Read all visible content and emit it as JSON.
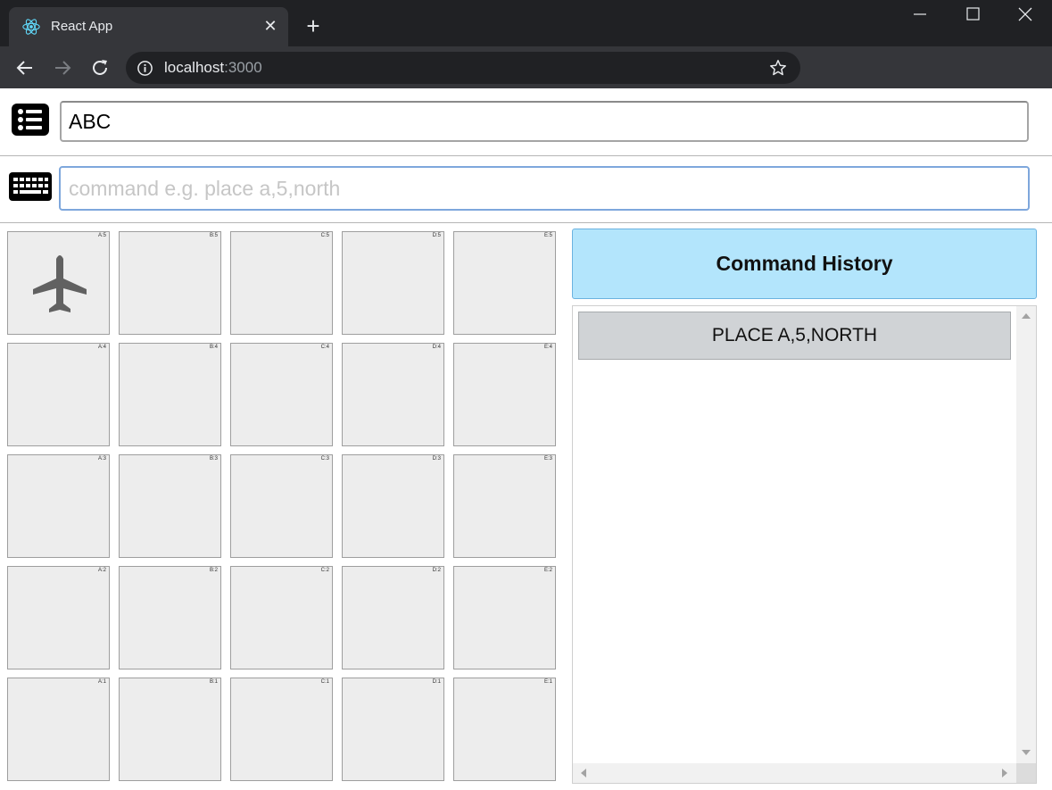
{
  "browser": {
    "tab_title": "React App",
    "url_host": "localhost",
    "url_port": ":3000",
    "icons": {
      "favicon": "react-logo-icon",
      "close_tab": "close-icon",
      "new_tab": "plus-icon",
      "back": "arrow-left-icon",
      "forward": "arrow-right-icon",
      "reload": "reload-icon",
      "site_info": "info-icon",
      "bookmark": "star-icon"
    }
  },
  "app": {
    "name_field": {
      "value": "ABC",
      "icon": "list-icon"
    },
    "command_field": {
      "value": "",
      "placeholder": "command e.g. place a,5,north",
      "icon": "keyboard-icon"
    },
    "grid": {
      "columns": [
        "A",
        "B",
        "C",
        "D",
        "E"
      ],
      "rows": [
        5,
        4,
        3,
        2,
        1
      ],
      "labels": [
        [
          "A:5",
          "B:5",
          "C:5",
          "D:5",
          "E:5"
        ],
        [
          "A:4",
          "B:4",
          "C:4",
          "D:4",
          "E:4"
        ],
        [
          "A:3",
          "B:3",
          "C:3",
          "D:3",
          "E:3"
        ],
        [
          "A:2",
          "B:2",
          "C:2",
          "D:2",
          "E:2"
        ],
        [
          "A:1",
          "B:1",
          "C:1",
          "D:1",
          "E:1"
        ]
      ],
      "plane": {
        "cell": "A:5",
        "facing": "NORTH",
        "icon": "airplane-icon"
      }
    },
    "history": {
      "title": "Command History",
      "items": [
        "PLACE A,5,NORTH"
      ]
    },
    "colors": {
      "history_header_bg": "#b3e5fc",
      "cell_bg": "#ededed",
      "history_item_bg": "#d0d3d6",
      "plane": "#616161"
    }
  }
}
